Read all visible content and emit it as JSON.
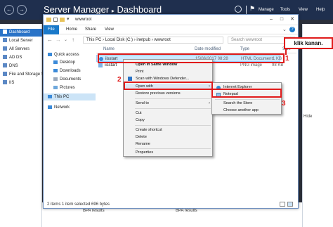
{
  "server_manager": {
    "title": "Server Manager",
    "separator": "▸",
    "page": "Dashboard",
    "menu": [
      "Manage",
      "Tools",
      "View",
      "Help"
    ],
    "sidebar": [
      "Dashboard",
      "Local Server",
      "All Servers",
      "AD DS",
      "DNS",
      "File and Storage Services",
      "IIS"
    ],
    "hide_label": "Hide",
    "bpa_label": "BPA results"
  },
  "explorer": {
    "title": "wwwroot",
    "tabs": [
      "File",
      "Home",
      "Share",
      "View"
    ],
    "breadcrumb": [
      "This PC",
      "Local Disk (C:)",
      "inetpub",
      "wwwroot"
    ],
    "search_placeholder": "Search wwwroot",
    "nav": [
      "Quick access",
      "Desktop",
      "Downloads",
      "Documents",
      "Pictures",
      "This PC",
      "Network"
    ],
    "columns": [
      "Name",
      "Date modified",
      "Type",
      "Size"
    ],
    "files": [
      {
        "name": "iisstart",
        "date": "15/06/2017 08:28",
        "type": "HTML Document",
        "size": "1 KB"
      },
      {
        "name": "iisstart",
        "date": "",
        "type": "PNG image",
        "size": "98 KB"
      }
    ],
    "status": "2 items    1 item selected  696 bytes"
  },
  "context_menu": {
    "items": [
      "Open in Same Window",
      "Print",
      "Scan with Windows Defender...",
      "Open with",
      "Restore previous versions",
      "Send to",
      "Cut",
      "Copy",
      "Create shortcut",
      "Delete",
      "Rename",
      "Properties"
    ],
    "submenu": [
      "Internet Explorer",
      "Notepad",
      "Search the Store",
      "Choose another app"
    ]
  },
  "annotations": {
    "callout": "klik kanan.",
    "steps": [
      "1",
      "2",
      "3"
    ],
    "color": "#e01b1b"
  },
  "colors": {
    "accent": "#1979ca",
    "titlebar": "#1f2f4e",
    "selection": "#cce8ff"
  }
}
